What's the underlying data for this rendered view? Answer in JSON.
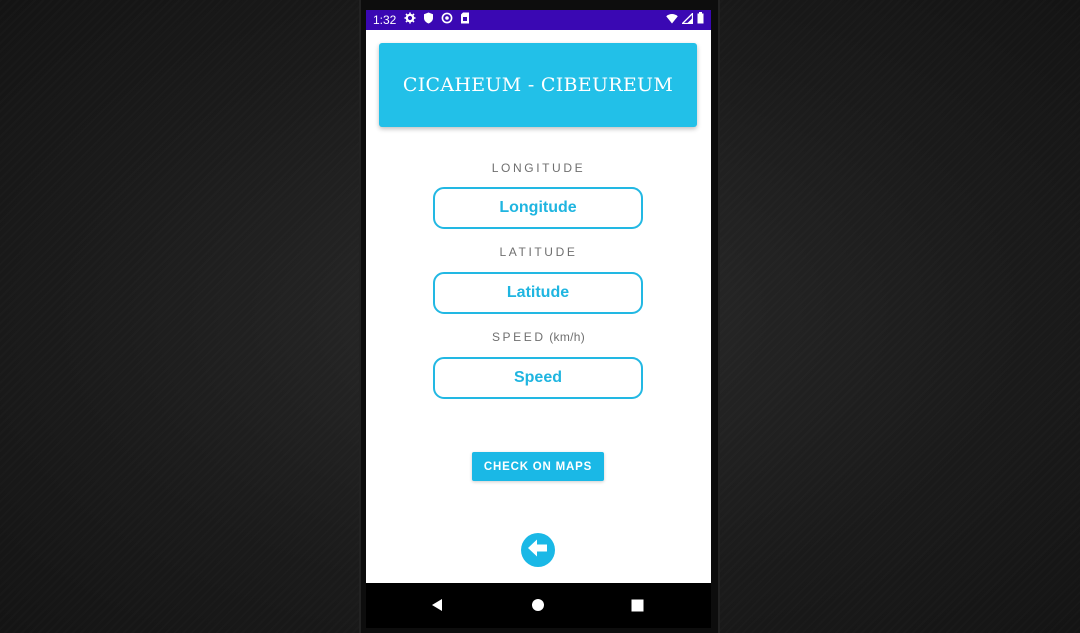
{
  "status_bar": {
    "time": "1:32",
    "left_icons": [
      "gear-icon",
      "shield-icon",
      "sync-icon",
      "sim-card-icon"
    ],
    "right_icons": [
      "wifi-icon",
      "signal-icon",
      "battery-icon"
    ]
  },
  "header": {
    "title": "CICAHEUM - CIBEUREUM"
  },
  "form": {
    "longitude": {
      "label": "LONGITUDE",
      "value": "Longitude"
    },
    "latitude": {
      "label": "LATITUDE",
      "value": "Latitude"
    },
    "speed": {
      "label": "SPEED",
      "unit": " (km/h)",
      "value": "Speed"
    }
  },
  "actions": {
    "check_on_maps": "CHECK ON MAPS",
    "back_icon": "arrow-left-icon"
  },
  "nav_bar": {
    "items": [
      "back-triangle-icon",
      "home-circle-icon",
      "recents-square-icon"
    ]
  },
  "colors": {
    "accent": "#22c0e8",
    "status_bar": "#3a08b3",
    "label_gray": "#6f6f6f"
  }
}
